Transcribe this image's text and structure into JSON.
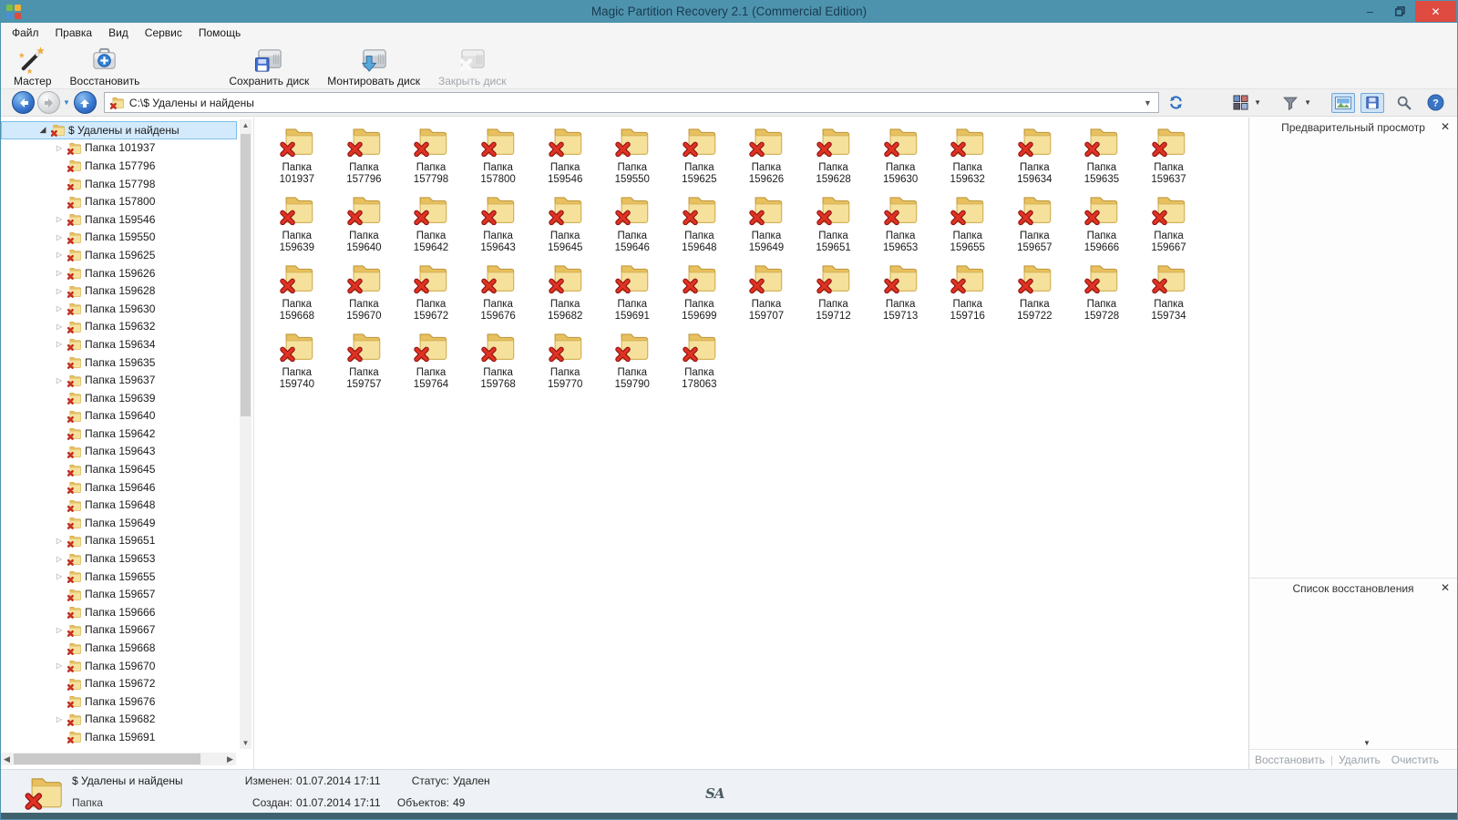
{
  "window": {
    "title": "Magic Partition Recovery 2.1 (Commercial Edition)"
  },
  "menu": {
    "items": [
      "Файл",
      "Правка",
      "Вид",
      "Сервис",
      "Помощь"
    ]
  },
  "toolbar": {
    "buttons": [
      {
        "label": "Мастер",
        "icon": "magic-wand",
        "enabled": true
      },
      {
        "label": "Восстановить",
        "icon": "restore-kit",
        "enabled": true
      },
      {
        "label": "Сохранить диск",
        "icon": "disk-save",
        "enabled": true
      },
      {
        "label": "Монтировать диск",
        "icon": "disk-mount",
        "enabled": true
      },
      {
        "label": "Закрыть диск",
        "icon": "disk-close",
        "enabled": false
      }
    ]
  },
  "address": {
    "path": "C:\\$ Удалены и найдены"
  },
  "tree": {
    "root": {
      "label": "$ Удалены и найдены",
      "selected": true
    },
    "items": [
      {
        "label": "Папка 101937",
        "expandable": true
      },
      {
        "label": "Папка 157796",
        "expandable": false
      },
      {
        "label": "Папка 157798",
        "expandable": false
      },
      {
        "label": "Папка 157800",
        "expandable": false
      },
      {
        "label": "Папка 159546",
        "expandable": true
      },
      {
        "label": "Папка 159550",
        "expandable": true
      },
      {
        "label": "Папка 159625",
        "expandable": true
      },
      {
        "label": "Папка 159626",
        "expandable": true
      },
      {
        "label": "Папка 159628",
        "expandable": true
      },
      {
        "label": "Папка 159630",
        "expandable": true
      },
      {
        "label": "Папка 159632",
        "expandable": true
      },
      {
        "label": "Папка 159634",
        "expandable": true
      },
      {
        "label": "Папка 159635",
        "expandable": false
      },
      {
        "label": "Папка 159637",
        "expandable": true
      },
      {
        "label": "Папка 159639",
        "expandable": false
      },
      {
        "label": "Папка 159640",
        "expandable": false
      },
      {
        "label": "Папка 159642",
        "expandable": false
      },
      {
        "label": "Папка 159643",
        "expandable": false
      },
      {
        "label": "Папка 159645",
        "expandable": false
      },
      {
        "label": "Папка 159646",
        "expandable": false
      },
      {
        "label": "Папка 159648",
        "expandable": false
      },
      {
        "label": "Папка 159649",
        "expandable": false
      },
      {
        "label": "Папка 159651",
        "expandable": true
      },
      {
        "label": "Папка 159653",
        "expandable": true
      },
      {
        "label": "Папка 159655",
        "expandable": true
      },
      {
        "label": "Папка 159657",
        "expandable": false
      },
      {
        "label": "Папка 159666",
        "expandable": false
      },
      {
        "label": "Папка 159667",
        "expandable": true
      },
      {
        "label": "Папка 159668",
        "expandable": false
      },
      {
        "label": "Папка 159670",
        "expandable": true
      },
      {
        "label": "Папка 159672",
        "expandable": false
      },
      {
        "label": "Папка 159676",
        "expandable": false
      },
      {
        "label": "Папка 159682",
        "expandable": true
      },
      {
        "label": "Папка 159691",
        "expandable": false
      }
    ]
  },
  "grid": {
    "name_line": "Папка",
    "folders": [
      "101937",
      "157796",
      "157798",
      "157800",
      "159546",
      "159550",
      "159625",
      "159626",
      "159628",
      "159630",
      "159632",
      "159634",
      "159635",
      "159637",
      "159639",
      "159640",
      "159642",
      "159643",
      "159645",
      "159646",
      "159648",
      "159649",
      "159651",
      "159653",
      "159655",
      "159657",
      "159666",
      "159667",
      "159668",
      "159670",
      "159672",
      "159676",
      "159682",
      "159691",
      "159699",
      "159707",
      "159712",
      "159713",
      "159716",
      "159722",
      "159728",
      "159734",
      "159740",
      "159757",
      "159764",
      "159768",
      "159770",
      "159790",
      "178063"
    ]
  },
  "preview_panel": {
    "title": "Предварительный просмотр",
    "close": "✕"
  },
  "recovery_panel": {
    "title": "Список восстановления",
    "close": "✕",
    "actions": {
      "restore": "Восстановить",
      "delete": "Удалить",
      "clear": "Очистить"
    }
  },
  "statusbar": {
    "name": "$ Удалены и найдены",
    "type": "Папка",
    "modified_label": "Изменен:",
    "modified_value": "01.07.2014 17:11",
    "created_label": "Создан:",
    "created_value": "01.07.2014 17:11",
    "status_label": "Статус:",
    "status_value": "Удален",
    "objects_label": "Объектов:",
    "objects_value": "49"
  },
  "watermark": "SA"
}
